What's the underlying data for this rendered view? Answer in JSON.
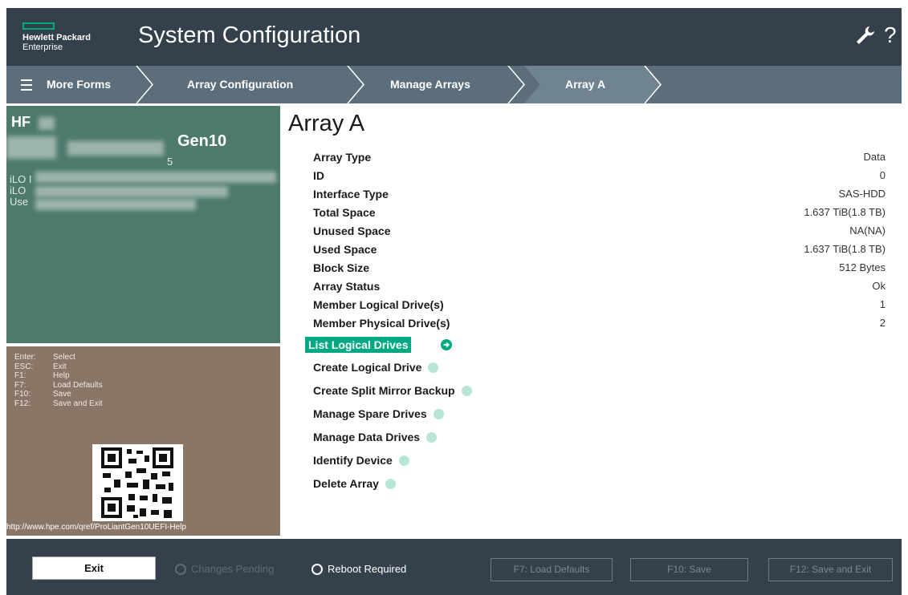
{
  "header": {
    "brand_line1": "Hewlett Packard",
    "brand_line2": "Enterprise",
    "title": "System Configuration"
  },
  "breadcrumb": {
    "more_forms": "More Forms",
    "items": [
      "Array Configuration",
      "Manage Arrays",
      "Array A"
    ]
  },
  "sidebar": {
    "model_fragment": "Gen10",
    "fragments": [
      "HF",
      "5",
      "iLO I",
      "iLO",
      "Use"
    ]
  },
  "key_help": [
    {
      "key": "Enter:",
      "action": "Select"
    },
    {
      "key": "ESC:",
      "action": "Exit"
    },
    {
      "key": "F1:",
      "action": "Help"
    },
    {
      "key": "F7:",
      "action": "Load Defaults"
    },
    {
      "key": "F10:",
      "action": "Save"
    },
    {
      "key": "F12:",
      "action": "Save and Exit"
    }
  ],
  "help_url": "http://www.hpe.com/qref/ProLiantGen10UEFI-Help",
  "main": {
    "title": "Array A",
    "properties": [
      {
        "label": "Array Type",
        "value": "Data"
      },
      {
        "label": "ID",
        "value": "0"
      },
      {
        "label": "Interface Type",
        "value": "SAS-HDD"
      },
      {
        "label": "Total Space",
        "value": "1.637 TiB(1.8 TB)"
      },
      {
        "label": "Unused Space",
        "value": "NA(NA)"
      },
      {
        "label": "Used Space",
        "value": "1.637 TiB(1.8 TB)"
      },
      {
        "label": "Block Size",
        "value": "512 Bytes"
      },
      {
        "label": "Array Status",
        "value": "Ok"
      },
      {
        "label": "Member Logical Drive(s)",
        "value": "1"
      },
      {
        "label": "Member Physical Drive(s)",
        "value": "2"
      }
    ],
    "actions": [
      "List Logical Drives",
      "Create Logical Drive",
      "Create Split Mirror Backup",
      "Manage Spare Drives",
      "Manage Data Drives",
      "Identify Device",
      "Delete Array"
    ]
  },
  "footer": {
    "exit": "Exit",
    "changes_pending": "Changes Pending",
    "reboot_required": "Reboot Required",
    "f7": "F7: Load Defaults",
    "f10": "F10: Save",
    "f12": "F12: Save and Exit"
  },
  "colors": {
    "accent": "#01a982",
    "header_bg": "#34404c",
    "breadcrumb_bg": "#5c6e7b",
    "sysinfo_bg": "#4e7a6e",
    "keyhelp_bg": "#8a7667"
  }
}
